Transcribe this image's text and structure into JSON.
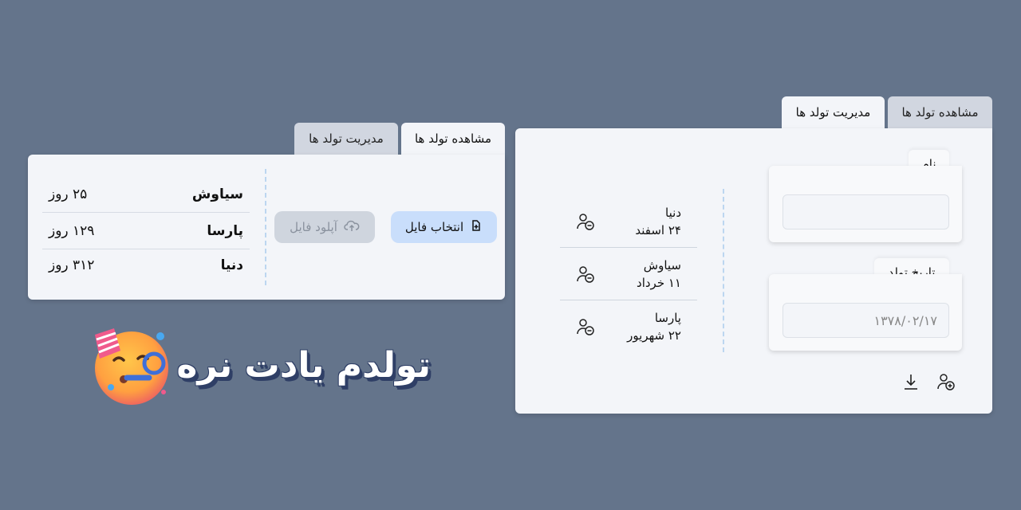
{
  "small_app": {
    "tabs": [
      {
        "label": "مشاهده تولد ها",
        "active": true
      },
      {
        "label": "مدیریت تولد ها",
        "active": false
      }
    ],
    "list": [
      {
        "name": "سیاوش",
        "days": "۲۵ روز"
      },
      {
        "name": "پارسا",
        "days": "۱۲۹ روز"
      },
      {
        "name": "دنیا",
        "days": "۳۱۲ روز"
      }
    ],
    "choose_file_label": "انتخاب فایل",
    "upload_file_label": "آپلود فایل"
  },
  "large_app": {
    "tabs": [
      {
        "label": "مشاهده تولد ها",
        "active": false
      },
      {
        "label": "مدیریت تولد ها",
        "active": true
      }
    ],
    "name_card": {
      "label": "نام",
      "value": ""
    },
    "birthdate_card": {
      "label": "تاریخ تولد",
      "value": "۱۳۷۸/۰۲/۱۷"
    },
    "people": [
      {
        "name": "دنیا",
        "date": "۲۴ اسفند"
      },
      {
        "name": "سیاوش",
        "date": "۱۱ خرداد"
      },
      {
        "name": "پارسا",
        "date": "۲۲ شهریور"
      }
    ]
  },
  "brand": {
    "logo_text": "تولدم یادت نره",
    "emoji": "🥳"
  },
  "colors": {
    "background": "#64748b",
    "panel": "#f3f5f9",
    "primary_button": "#c9defb",
    "logo_text": "#ffffff",
    "logo_shadow": "#2f3f66"
  }
}
